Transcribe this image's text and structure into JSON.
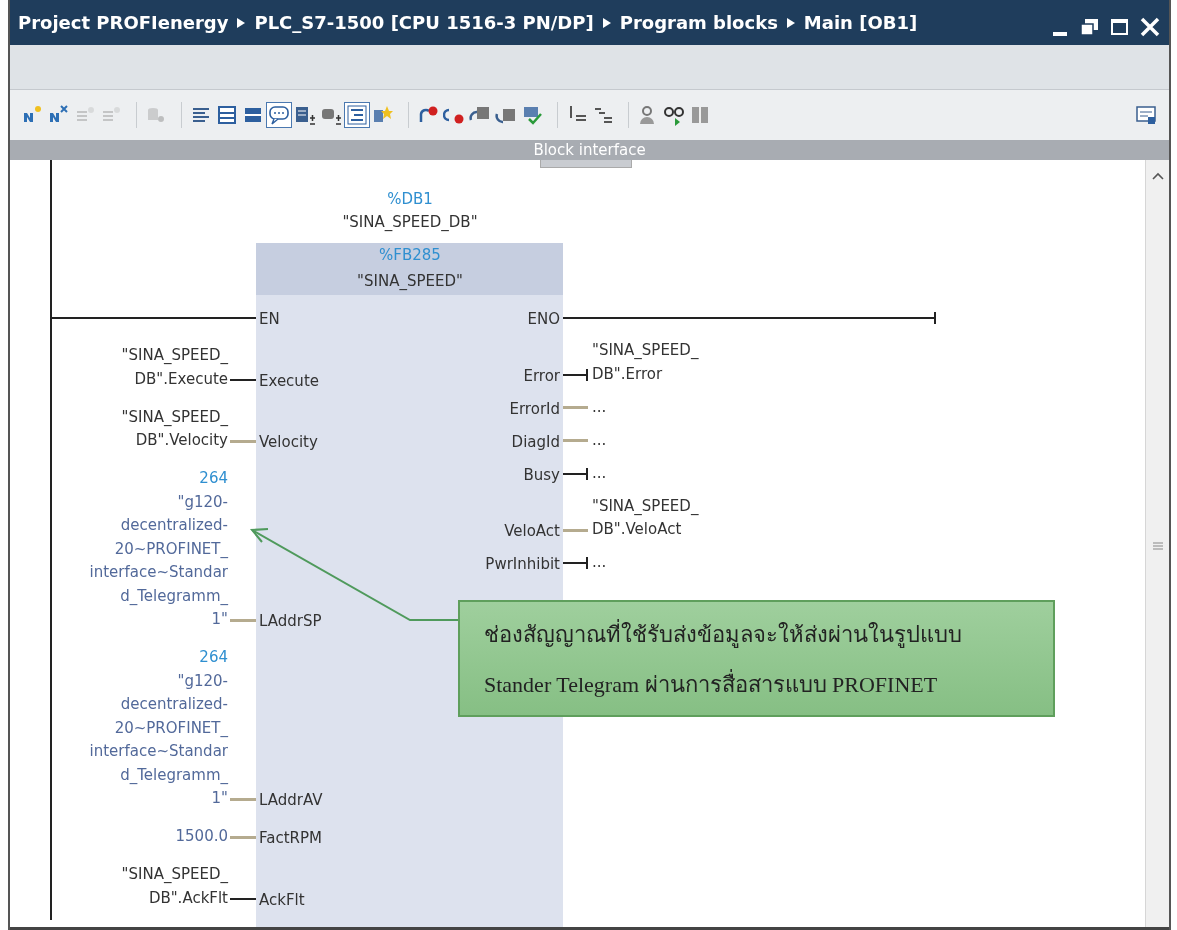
{
  "breadcrumb": [
    "Project PROFIenergy",
    "PLC_S7-1500 [CPU 1516-3 PN/DP]",
    "Program blocks",
    "Main [OB1]"
  ],
  "toolbar": [
    [
      {
        "selected": false,
        "disabled": false
      },
      {
        "selected": false,
        "disabled": false
      },
      {
        "selected": false,
        "disabled": true
      },
      {
        "selected": false,
        "disabled": true
      }
    ],
    [
      {
        "selected": false,
        "disabled": true
      }
    ],
    [
      {
        "selected": false,
        "disabled": false
      },
      {
        "selected": false,
        "disabled": false
      },
      {
        "selected": false,
        "disabled": false
      },
      {
        "selected": true,
        "disabled": false
      },
      {
        "selected": false,
        "disabled": false
      },
      {
        "selected": false,
        "disabled": false
      },
      {
        "selected": true,
        "disabled": false
      },
      {
        "selected": false,
        "disabled": false
      }
    ],
    [
      {
        "selected": false,
        "disabled": false
      },
      {
        "selected": false,
        "disabled": false
      },
      {
        "selected": false,
        "disabled": false
      },
      {
        "selected": false,
        "disabled": false
      },
      {
        "selected": false,
        "disabled": false
      }
    ],
    [
      {
        "selected": false,
        "disabled": false
      },
      {
        "selected": false,
        "disabled": false
      }
    ],
    [
      {
        "selected": false,
        "disabled": false
      },
      {
        "selected": false,
        "disabled": false
      },
      {
        "selected": false,
        "disabled": false
      }
    ]
  ],
  "panel_title": "Block interface",
  "instance": {
    "address": "%DB1",
    "name": "\"SINA_SPEED_DB\""
  },
  "block": {
    "address": "%FB285",
    "name": "\"SINA_SPEED\""
  },
  "inputs": [
    {
      "pin": "EN",
      "kind": "bool"
    },
    {
      "pin": "Execute",
      "kind": "bool",
      "operand": [
        {
          "kind": "tag",
          "lines": [
            "\"SINA_SPEED_",
            "DB\".Execute"
          ]
        }
      ]
    },
    {
      "pin": "Velocity",
      "kind": "value",
      "operand": [
        {
          "kind": "tag",
          "lines": [
            "\"SINA_SPEED_",
            "DB\".Velocity"
          ]
        }
      ]
    },
    {
      "pin": "LAddrSP",
      "kind": "value",
      "operand": [
        {
          "kind": "address",
          "lines": [
            "264"
          ]
        },
        {
          "kind": "constant",
          "lines": [
            "\"g120-",
            "decentralized-",
            "20~PROFINET_",
            "interface~Standar",
            "d_Telegramm_",
            "1\""
          ]
        }
      ]
    },
    {
      "pin": "LAddrAV",
      "kind": "value",
      "operand": [
        {
          "kind": "address",
          "lines": [
            "264"
          ]
        },
        {
          "kind": "constant",
          "lines": [
            "\"g120-",
            "decentralized-",
            "20~PROFINET_",
            "interface~Standar",
            "d_Telegramm_",
            "1\""
          ]
        }
      ]
    },
    {
      "pin": "FactRPM",
      "kind": "value",
      "operand": [
        {
          "kind": "constant",
          "lines": [
            "1500.0"
          ]
        }
      ]
    },
    {
      "pin": "AckFlt",
      "kind": "bool",
      "operand": [
        {
          "kind": "tag",
          "lines": [
            "\"SINA_SPEED_",
            "DB\".AckFlt"
          ]
        }
      ]
    }
  ],
  "outputs": [
    {
      "pin": "ENO",
      "kind": "bool"
    },
    {
      "pin": "Error",
      "kind": "bool",
      "operand": [
        {
          "kind": "tag",
          "lines": [
            "\"SINA_SPEED_",
            "DB\".Error"
          ]
        }
      ]
    },
    {
      "pin": "ErrorId",
      "kind": "value",
      "operand": [
        {
          "kind": "tag",
          "lines": [
            "..."
          ]
        }
      ]
    },
    {
      "pin": "DiagId",
      "kind": "value",
      "operand": [
        {
          "kind": "tag",
          "lines": [
            "..."
          ]
        }
      ]
    },
    {
      "pin": "Busy",
      "kind": "bool",
      "operand": [
        {
          "kind": "tag",
          "lines": [
            "..."
          ]
        }
      ]
    },
    {
      "pin": "VeloAct",
      "kind": "value",
      "operand": [
        {
          "kind": "tag",
          "lines": [
            "\"SINA_SPEED_",
            "DB\".VeloAct"
          ]
        }
      ]
    },
    {
      "pin": "PwrInhibit",
      "kind": "bool",
      "operand": [
        {
          "kind": "tag",
          "lines": [
            "..."
          ]
        }
      ]
    }
  ],
  "callout": {
    "lines": [
      "ช่องสัญญาณที่ใช้รับส่งข้อมูลจะให้ส่งผ่านในรูปแบบ",
      "Stander Telegram ผ่านการสื่อสารแบบ  PROFINET"
    ]
  }
}
